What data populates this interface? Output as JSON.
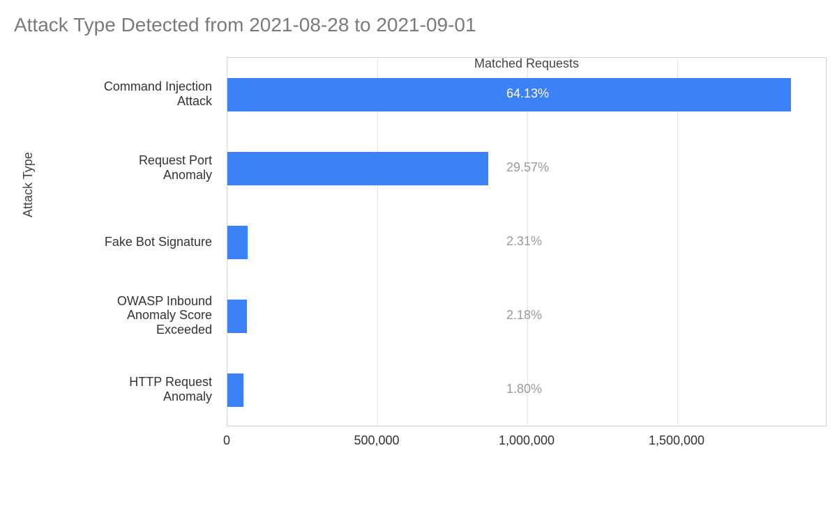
{
  "chart_data": {
    "type": "bar",
    "orientation": "horizontal",
    "title": "Attack Type Detected from 2021-08-28 to 2021-09-01",
    "xlabel": "Matched Requests",
    "ylabel": "Attack Type",
    "categories": [
      "Command Injection Attack",
      "Request Port Anomaly",
      "Fake Bot Signature",
      "OWASP Inbound Anomaly Score Exceeded",
      "HTTP Request Anomaly"
    ],
    "values": [
      1880000,
      870000,
      68000,
      64000,
      53000
    ],
    "percent_labels": [
      "64.13%",
      "29.57%",
      "2.31%",
      "2.18%",
      "1.80%"
    ],
    "bar_color": "#3c81f6",
    "xlim": [
      0,
      2000000
    ],
    "x_ticks": [
      0,
      500000,
      1000000,
      1500000
    ],
    "x_tick_labels": [
      "0",
      "500,000",
      "1,000,000",
      "1,500,000"
    ]
  }
}
